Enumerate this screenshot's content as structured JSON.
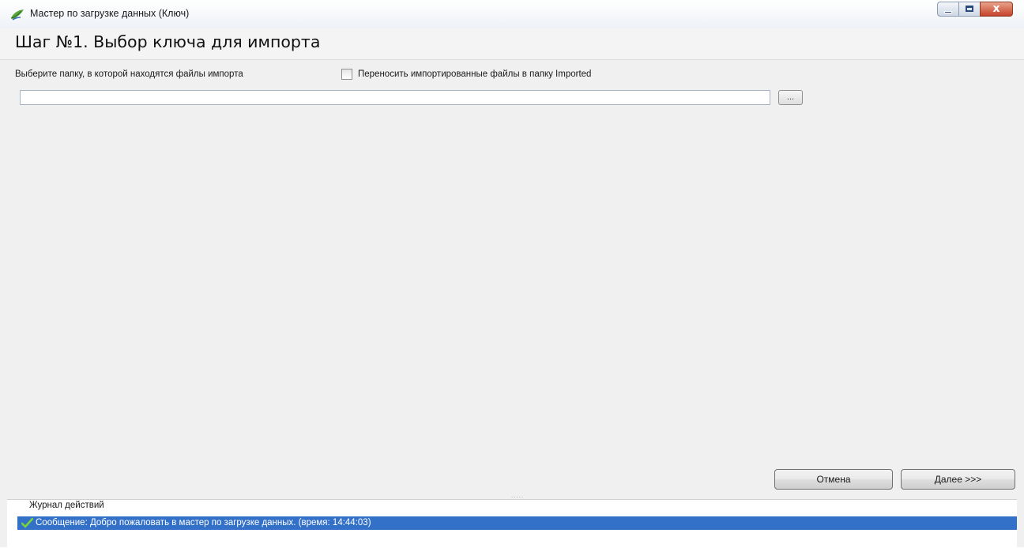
{
  "window": {
    "title": "Мастер по загрузке данных (Ключ)",
    "controls": {
      "minimize": "minimize",
      "maximize": "maximize",
      "close": "x"
    }
  },
  "step": {
    "title": "Шаг №1.  Выбор ключа для импорта"
  },
  "import": {
    "folder_label": "Выберите папку, в которой находятся файлы импорта",
    "move_checkbox_label": "Переносить импортированные файлы в папку Imported",
    "move_checkbox_checked": false,
    "path_value": "",
    "browse_label": "..."
  },
  "footer": {
    "cancel_label": "Отмена",
    "next_label": "Далее >>>"
  },
  "splitter": {
    "grip": "....."
  },
  "log": {
    "title": "Журнал действий",
    "entries": [
      {
        "text": "Сообщение: Добро пожаловать в мастер по загрузке данных. (время: 14:44:03)",
        "icon": "check-icon"
      }
    ]
  },
  "colors": {
    "selection": "#3370c8",
    "background": "#f0f0f0",
    "close_button": "#c5432a"
  }
}
